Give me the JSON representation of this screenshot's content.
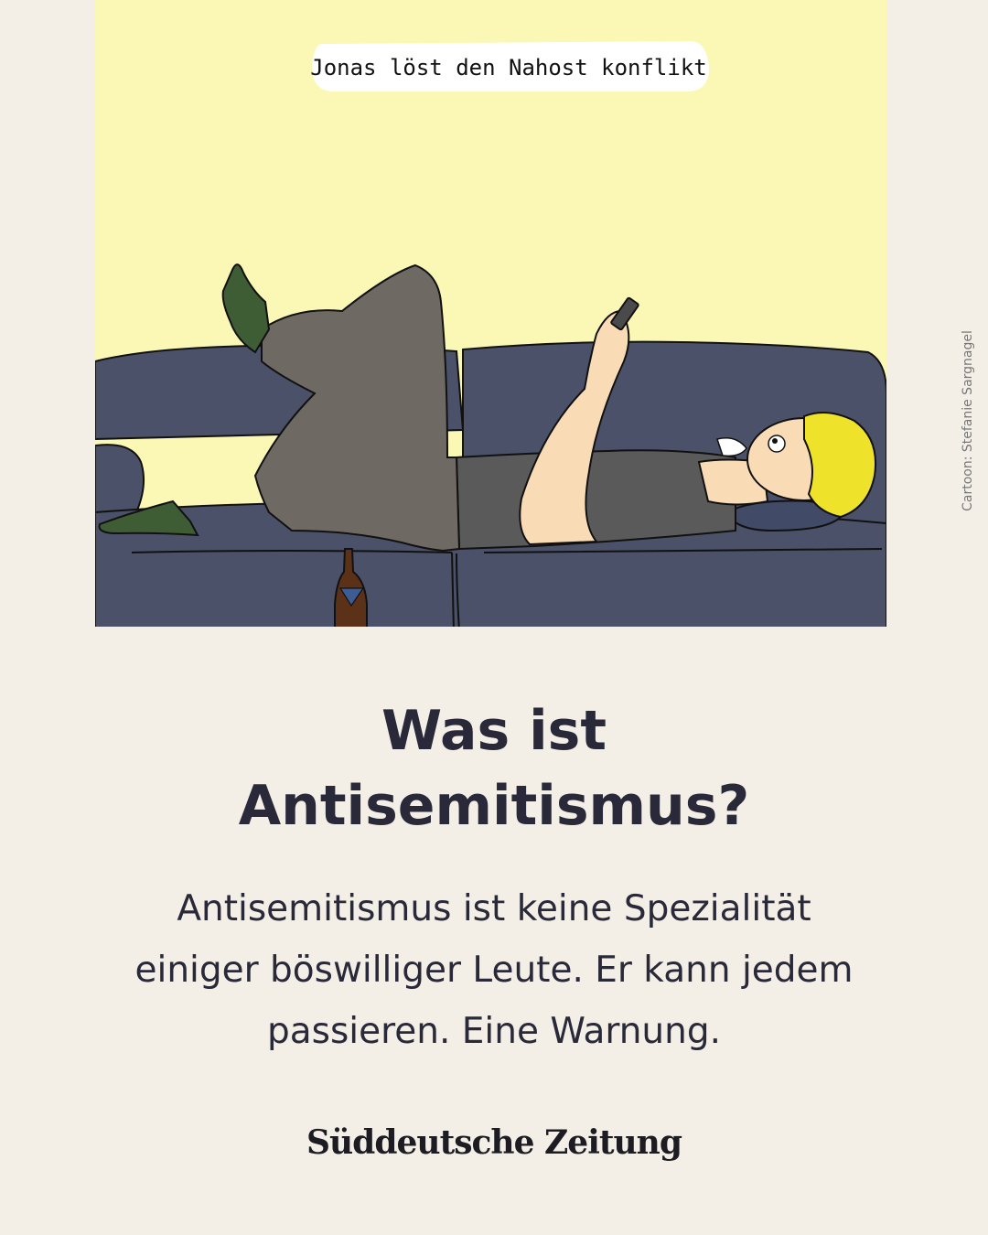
{
  "cartoon": {
    "speech_bubble": "Jonas löst den Nahost konflikt",
    "credit": "Cartoon: Stefanie Sargnagel"
  },
  "article": {
    "headline_line1": "Was ist",
    "headline_line2": "Antisemitismus?",
    "deck_line1": "Antisemitismus ist keine Spezialität",
    "deck_line2": "einiger böswilliger Leute. Er kann jedem",
    "deck_line3": "passieren. Eine Warnung."
  },
  "brand": {
    "logo": "Süddeutsche Zeitung"
  },
  "colors": {
    "background": "#f3efe6",
    "sky": "#fbf7b4",
    "sofa": "#4a5168",
    "text": "#29293a"
  }
}
